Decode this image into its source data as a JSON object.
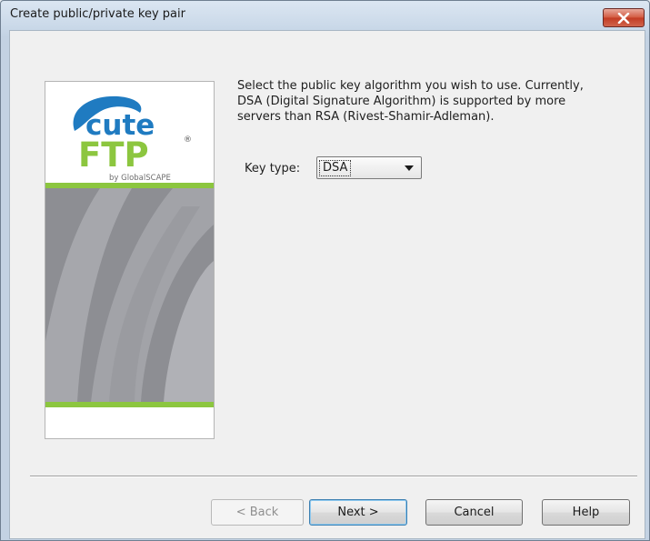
{
  "window": {
    "title": "Create public/private key pair",
    "close_icon": "close-icon"
  },
  "banner": {
    "logo_word_cute": "cute",
    "logo_word_ftp": "FTP",
    "logo_registered": "®",
    "logo_byline": "by GlobalSCAPE",
    "colors": {
      "accent_green": "#8cc63f",
      "logo_blue": "#1f7bc1",
      "art_gray": "#8e8f94"
    }
  },
  "main": {
    "description": "Select the public key algorithm you wish to use. Currently,\nDSA (Digital Signature Algorithm) is supported by more\nservers than RSA (Rivest-Shamir-Adleman).",
    "key_type_label": "Key type:",
    "key_type_value": "DSA"
  },
  "buttons": {
    "back": "< Back",
    "next": "Next >",
    "cancel": "Cancel",
    "help": "Help"
  }
}
